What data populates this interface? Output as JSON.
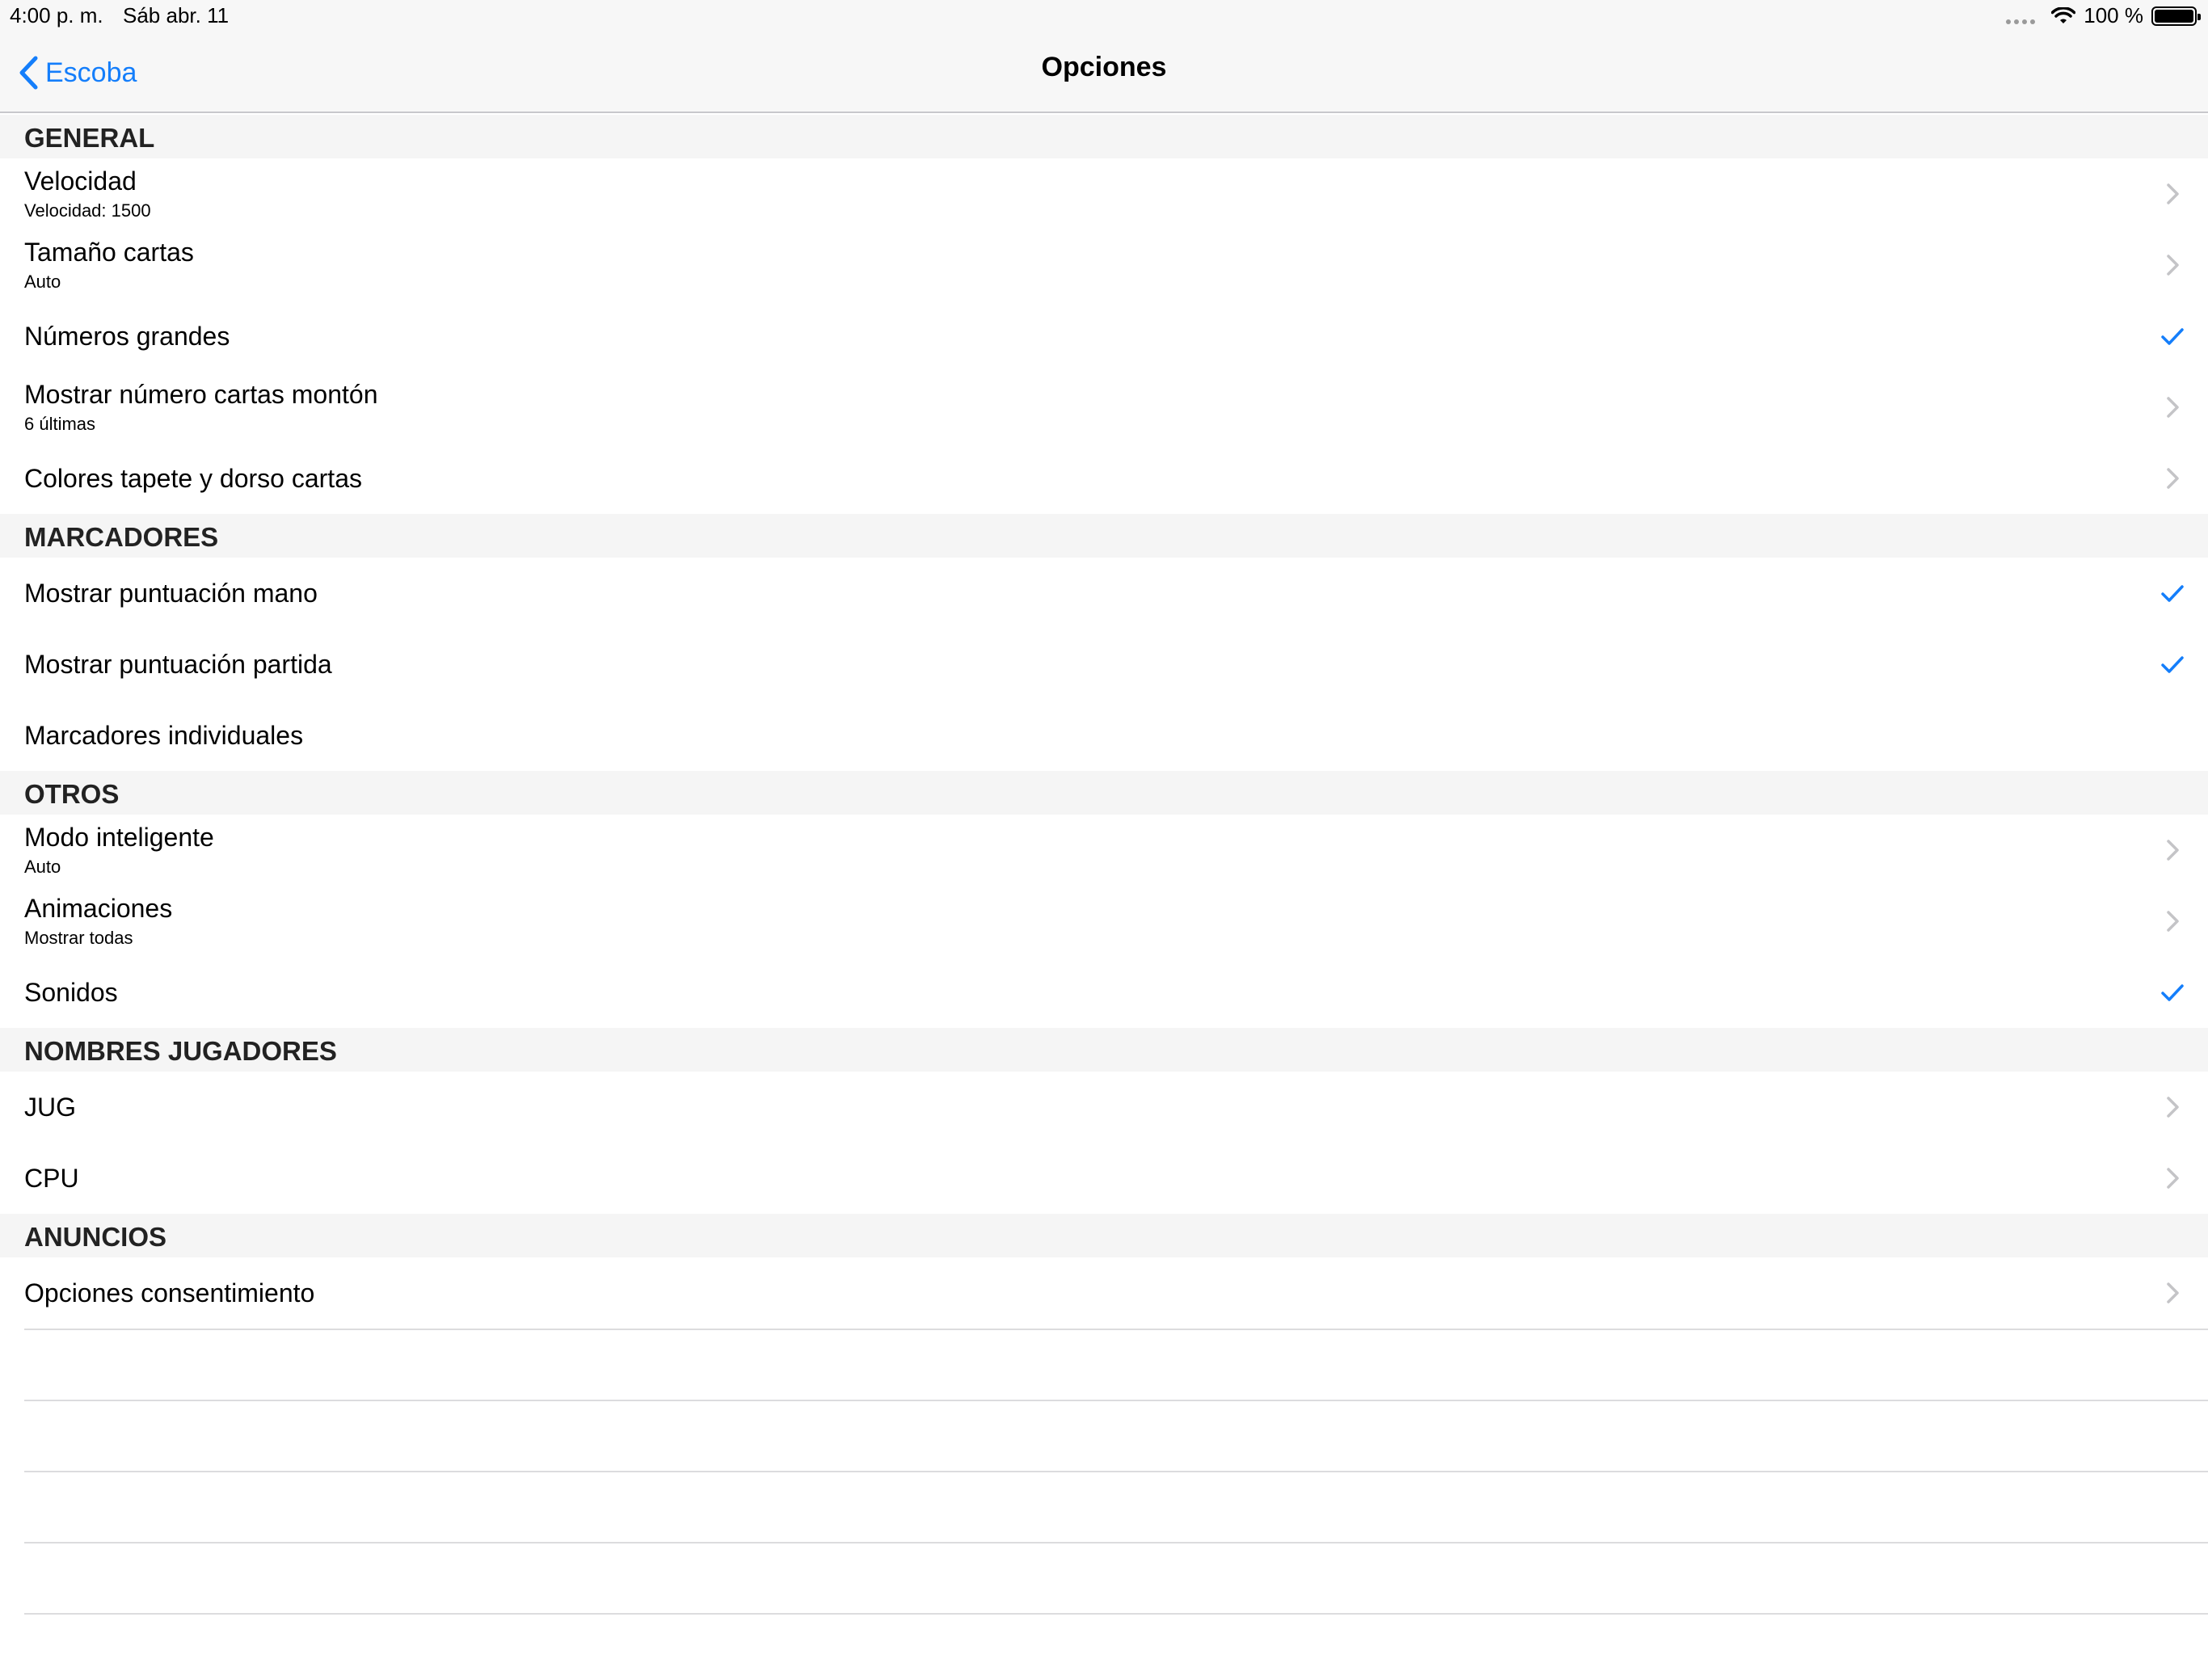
{
  "status_bar": {
    "time": "4:00 p. m.",
    "date": "Sáb abr. 11",
    "battery": "100 %"
  },
  "nav": {
    "back_label": "Escoba",
    "title": "Opciones"
  },
  "colors": {
    "accent": "#147efb",
    "chevron": "#c4c4c7"
  },
  "sections": [
    {
      "header": "GENERAL",
      "rows": [
        {
          "label": "Velocidad",
          "detail": "Velocidad: 1500",
          "accessory": "chevron-icon"
        },
        {
          "label": "Tamaño cartas",
          "detail": "Auto",
          "accessory": "chevron-icon"
        },
        {
          "label": "Números grandes",
          "detail": "",
          "accessory": "checkmark-icon"
        },
        {
          "label": "Mostrar número cartas montón",
          "detail": "6 últimas",
          "accessory": "chevron-icon"
        },
        {
          "label": "Colores tapete y dorso cartas",
          "detail": "",
          "accessory": "chevron-icon"
        }
      ]
    },
    {
      "header": "MARCADORES",
      "rows": [
        {
          "label": "Mostrar puntuación mano",
          "detail": "",
          "accessory": "checkmark-icon"
        },
        {
          "label": "Mostrar puntuación partida",
          "detail": "",
          "accessory": "checkmark-icon"
        },
        {
          "label": "Marcadores individuales",
          "detail": "",
          "accessory": ""
        }
      ]
    },
    {
      "header": "OTROS",
      "rows": [
        {
          "label": "Modo inteligente",
          "detail": "Auto",
          "accessory": "chevron-icon"
        },
        {
          "label": "Animaciones",
          "detail": "Mostrar todas",
          "accessory": "chevron-icon"
        },
        {
          "label": "Sonidos",
          "detail": "",
          "accessory": "checkmark-icon"
        }
      ]
    },
    {
      "header": "NOMBRES JUGADORES",
      "rows": [
        {
          "label": "JUG",
          "detail": "",
          "accessory": "chevron-icon"
        },
        {
          "label": "CPU",
          "detail": "",
          "accessory": "chevron-icon"
        }
      ]
    },
    {
      "header": "ANUNCIOS",
      "rows": [
        {
          "label": "Opciones consentimiento",
          "detail": "",
          "accessory": "chevron-icon"
        }
      ]
    }
  ]
}
